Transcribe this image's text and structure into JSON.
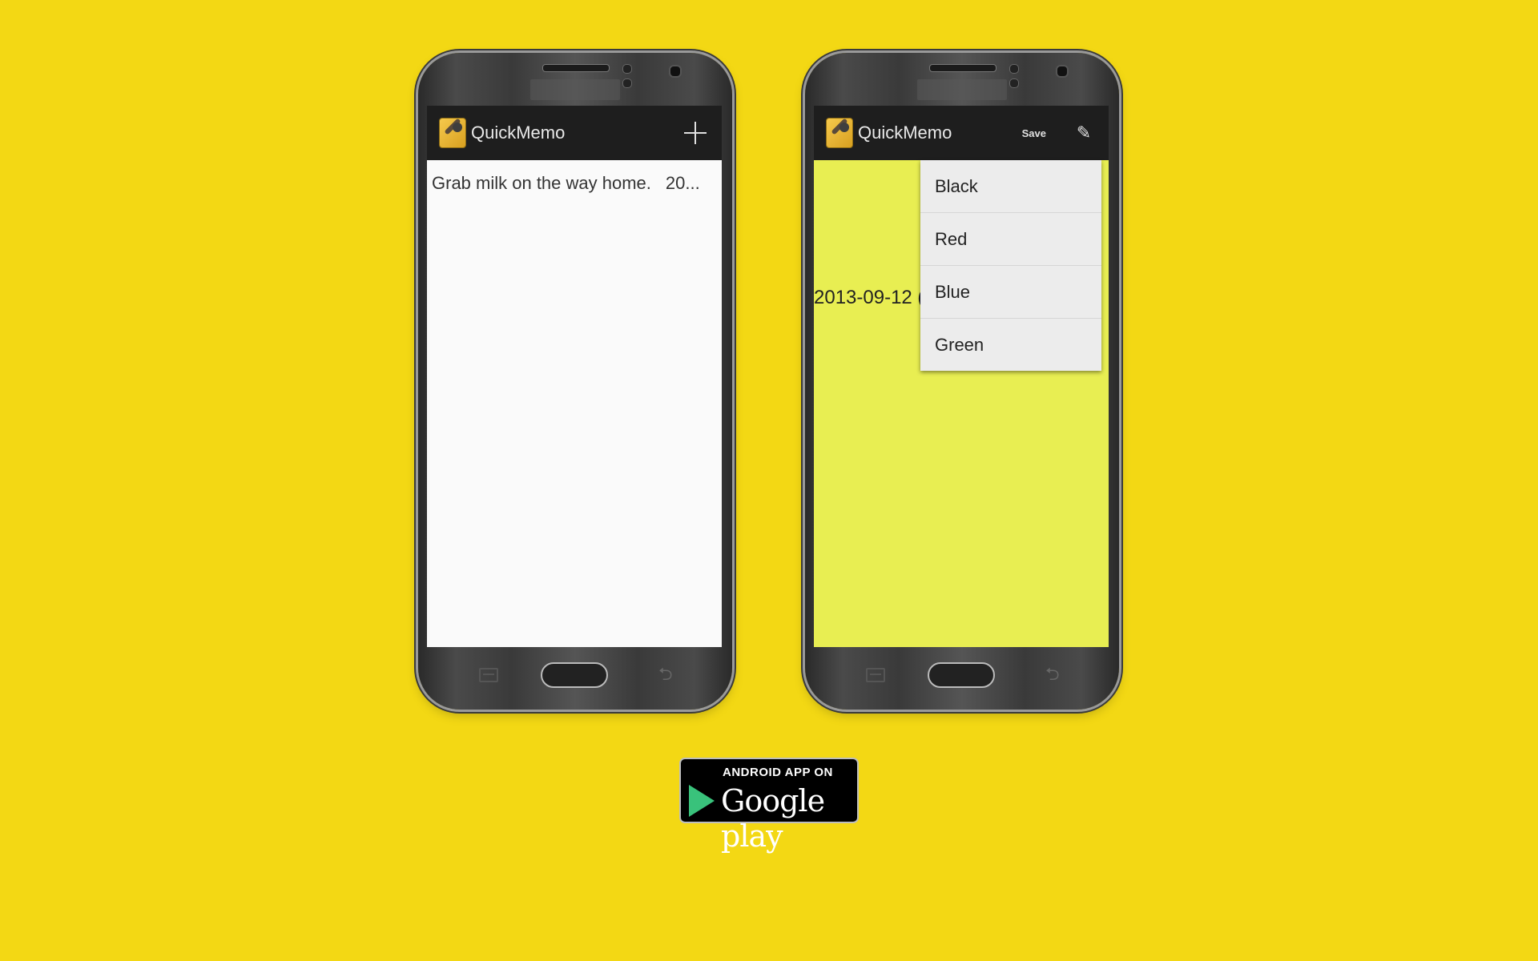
{
  "left_phone": {
    "app_title": "QuickMemo",
    "memo_text": "Grab milk on the way home.",
    "memo_date": "20..."
  },
  "right_phone": {
    "app_title": "QuickMemo",
    "save_label": "Save",
    "date_text": "2013-09-12 (",
    "menu_items": [
      "Black",
      "Red",
      "Blue",
      "Green"
    ]
  },
  "badge": {
    "top_text": "ANDROID APP ON",
    "main_text": "Google play"
  },
  "colors": {
    "background": "#f3d814",
    "note_yellow": "#e8ee52",
    "actionbar": "#1e1e1e"
  },
  "icons": [
    "plus-icon",
    "pencil-icon",
    "app-pin-icon",
    "menu-icon",
    "home-icon",
    "back-icon",
    "play-triangle-icon"
  ]
}
